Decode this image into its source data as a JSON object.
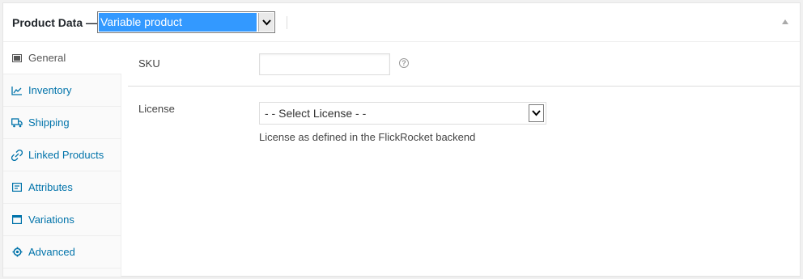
{
  "header": {
    "title": "Product Data —",
    "product_type_value": "Variable product"
  },
  "tabs": [
    {
      "label": "General",
      "icon": "general-icon",
      "active": true
    },
    {
      "label": "Inventory",
      "icon": "inventory-icon"
    },
    {
      "label": "Shipping",
      "icon": "truck-icon"
    },
    {
      "label": "Linked Products",
      "icon": "link-icon"
    },
    {
      "label": "Attributes",
      "icon": "attributes-icon"
    },
    {
      "label": "Variations",
      "icon": "variations-icon"
    },
    {
      "label": "Advanced",
      "icon": "gear-icon"
    }
  ],
  "fields": {
    "sku_label": "SKU",
    "sku_value": "",
    "license_label": "License",
    "license_value": "- - Select License - -",
    "license_description": "License as defined in the FlickRocket backend"
  },
  "colors": {
    "link": "#0073aa",
    "selection": "#3399ff"
  }
}
